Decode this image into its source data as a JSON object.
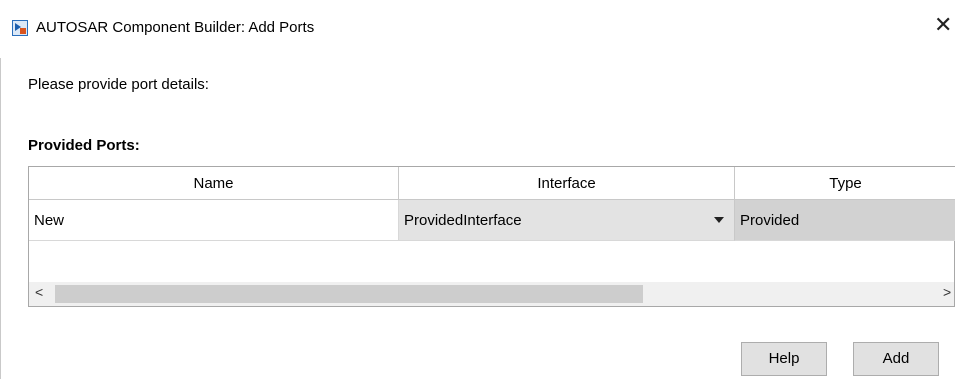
{
  "window": {
    "title": "AUTOSAR Component Builder: Add Ports",
    "close_glyph": "✕"
  },
  "prompt": "Please provide port details:",
  "section_title": "Provided Ports:",
  "table": {
    "columns": [
      "Name",
      "Interface",
      "Type"
    ],
    "rows": [
      {
        "name": "New",
        "interface": "ProvidedInterface",
        "type": "Provided"
      }
    ]
  },
  "scrollbar": {
    "left_glyph": "<",
    "right_glyph": ">"
  },
  "buttons": {
    "help": "Help",
    "add": "Add"
  },
  "icons": {
    "app": "simulink-app-icon",
    "close": "close-icon",
    "dropdown": "dropdown-arrow-icon"
  }
}
